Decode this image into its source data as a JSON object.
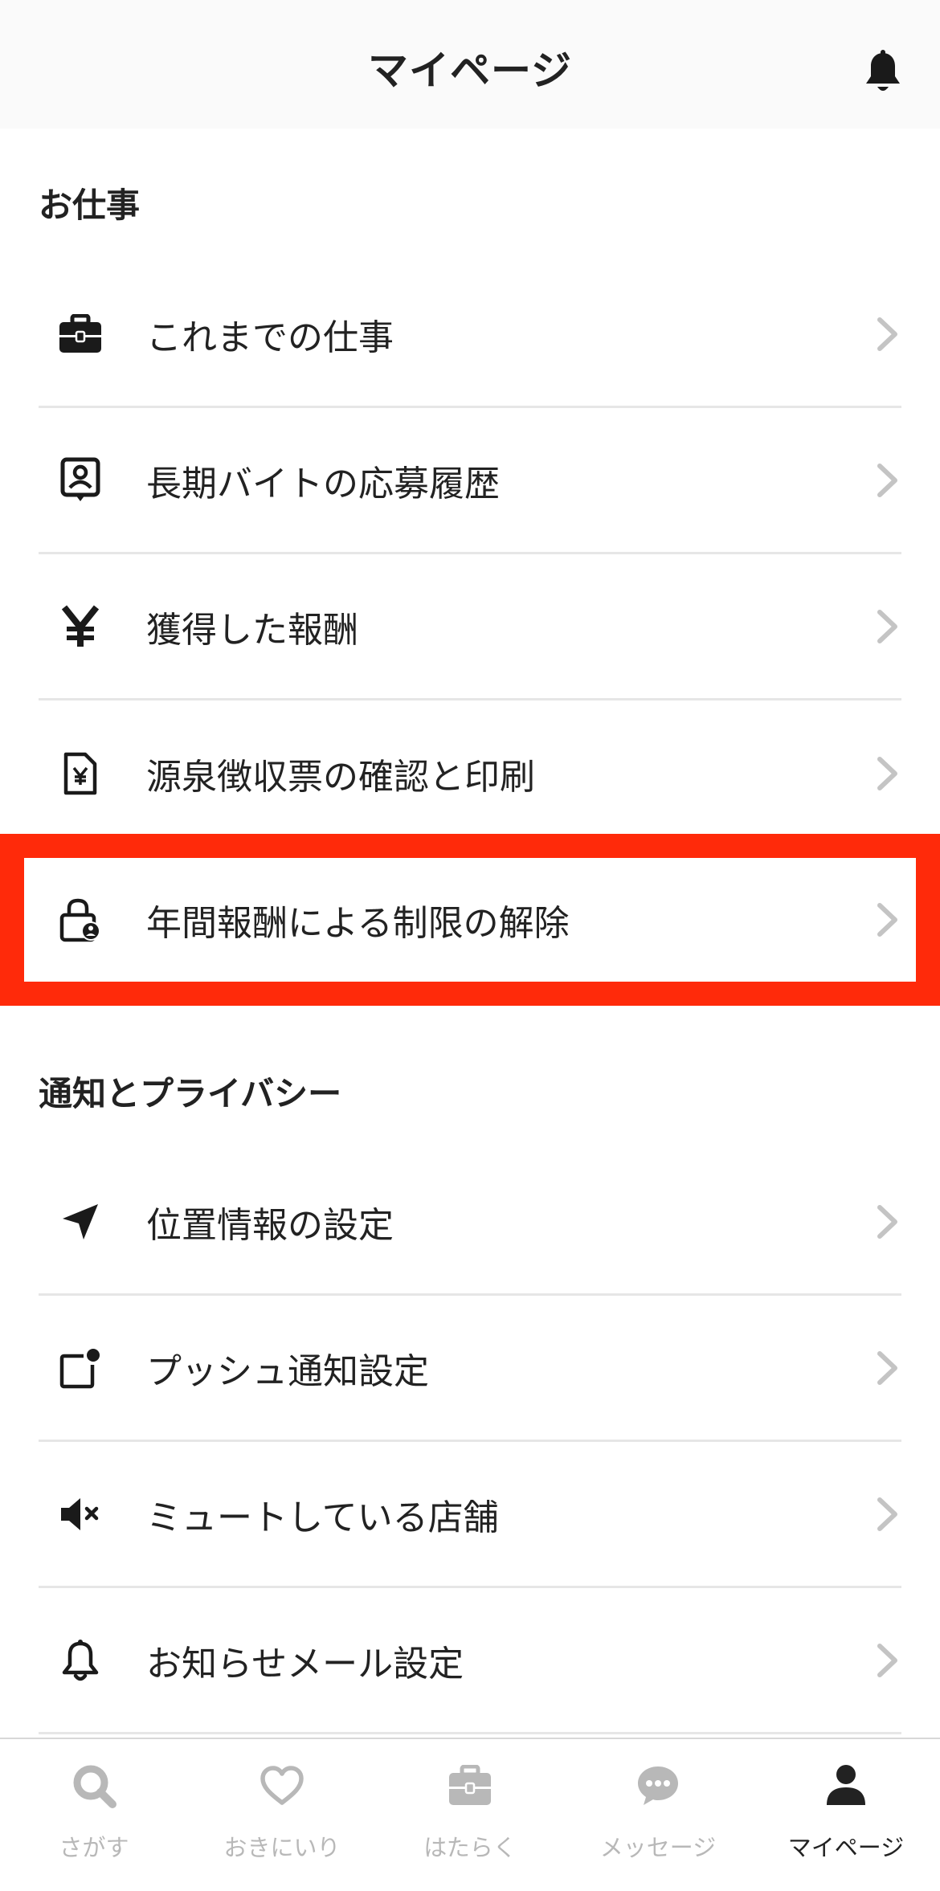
{
  "header": {
    "title": "マイページ",
    "bell_icon": "bell-icon"
  },
  "sections": {
    "work": {
      "heading": "お仕事",
      "items": [
        {
          "label": "これまでの仕事",
          "icon": "briefcase-icon"
        },
        {
          "label": "長期バイトの応募履歴",
          "icon": "profile-card-icon"
        },
        {
          "label": "獲得した報酬",
          "icon": "yen-icon"
        },
        {
          "label": "源泉徴収票の確認と印刷",
          "icon": "yen-document-icon"
        },
        {
          "label": "年間報酬による制限の解除",
          "icon": "lock-user-icon"
        }
      ]
    },
    "privacy": {
      "heading": "通知とプライバシー",
      "items": [
        {
          "label": "位置情報の設定",
          "icon": "location-arrow-icon"
        },
        {
          "label": "プッシュ通知設定",
          "icon": "push-notification-icon"
        },
        {
          "label": "ミュートしている店舗",
          "icon": "mute-speaker-icon"
        },
        {
          "label": "お知らせメール設定",
          "icon": "bell-icon"
        }
      ]
    }
  },
  "highlight_color": "#ff2a0a",
  "bottom_nav": {
    "items": [
      {
        "label": "さがす",
        "icon": "search-icon"
      },
      {
        "label": "おきにいり",
        "icon": "heart-icon"
      },
      {
        "label": "はたらく",
        "icon": "briefcase-icon"
      },
      {
        "label": "メッセージ",
        "icon": "chat-bubble-icon"
      },
      {
        "label": "マイページ",
        "icon": "person-icon",
        "active": true
      }
    ]
  }
}
